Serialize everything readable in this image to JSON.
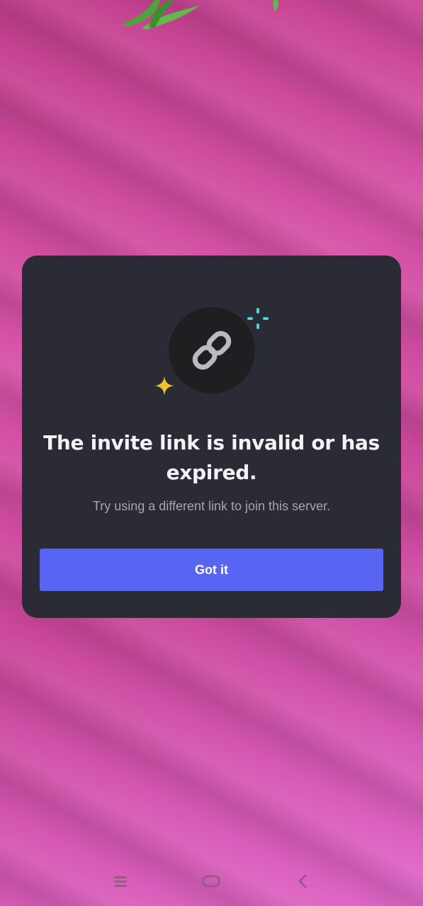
{
  "dialog": {
    "icon": "link-icon",
    "title": "The invite link is invalid or has expired.",
    "subtitle": "Try using a different link to join this server.",
    "button_label": "Got it"
  },
  "navbar": {
    "items": [
      "recent-apps-icon",
      "home-icon",
      "back-icon"
    ]
  },
  "colors": {
    "background": "#d14fa3",
    "dialog": "#2a2b34",
    "icon_circle": "#1f1f22",
    "primary_button": "#5865f2",
    "title_text": "#f2f3f5",
    "subtitle_text": "#a3a6ad",
    "sparkle_yellow": "#f0c330",
    "sparkle_teal": "#4fd1d9"
  }
}
